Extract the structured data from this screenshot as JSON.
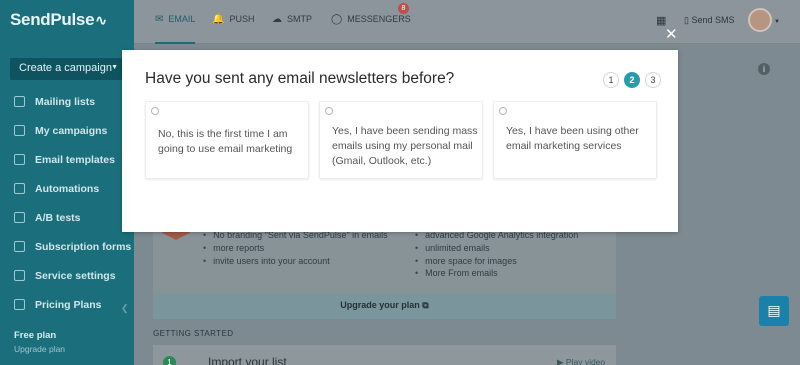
{
  "app": {
    "logo": "SendPulse",
    "create_campaign": "Create a campaign",
    "sidebar_items": [
      {
        "label": "Mailing lists",
        "icon": "list-icon"
      },
      {
        "label": "My campaigns",
        "icon": "rocket-icon"
      },
      {
        "label": "Email templates",
        "icon": "template-icon"
      },
      {
        "label": "Automations",
        "icon": "automation-icon"
      },
      {
        "label": "A/B tests",
        "icon": "ab-test-icon"
      },
      {
        "label": "Subscription forms",
        "icon": "form-icon"
      },
      {
        "label": "Service settings",
        "icon": "settings-icon"
      },
      {
        "label": "Pricing Plans",
        "icon": "pricing-icon"
      }
    ],
    "plan_name": "Free plan",
    "upgrade_plan_link": "Upgrade plan",
    "tabs": [
      {
        "label": "EMAIL",
        "icon": "email-icon",
        "active": true
      },
      {
        "label": "PUSH",
        "icon": "bell-icon",
        "active": false
      },
      {
        "label": "SMTP",
        "icon": "cloud-icon",
        "active": false
      },
      {
        "label": "MESSENGERS",
        "icon": "chat-bubble-icon",
        "active": false,
        "badge": "8"
      }
    ],
    "send_sms": "Send SMS",
    "features_left": [
      "No branding \"Sent via SendPulse\" in emails",
      "more reports",
      "invite users into your account"
    ],
    "features_right": [
      "advanced Google Analytics integration",
      "unlimited emails",
      "more space for images",
      "More From emails"
    ],
    "upgrade_your_plan": "Upgrade your plan",
    "getting_started": "GETTING STARTED",
    "import_step_number": "1",
    "import_title": "Import your list",
    "play_video": "Play video"
  },
  "modal": {
    "title": "Have you sent any email newsletters before?",
    "steps": [
      "1",
      "2",
      "3"
    ],
    "current_step": 2,
    "options": [
      "No, this is the first time I am going to use email marketing",
      "Yes, I have been sending mass emails using my personal mail (Gmail, Outlook, etc.)",
      "Yes, I have been using other email marketing services"
    ]
  },
  "colors": {
    "sidebar": "#1b6f7c",
    "accent": "#2a9bab",
    "badge": "#b9524b",
    "chat_button": "#1a82a8"
  }
}
